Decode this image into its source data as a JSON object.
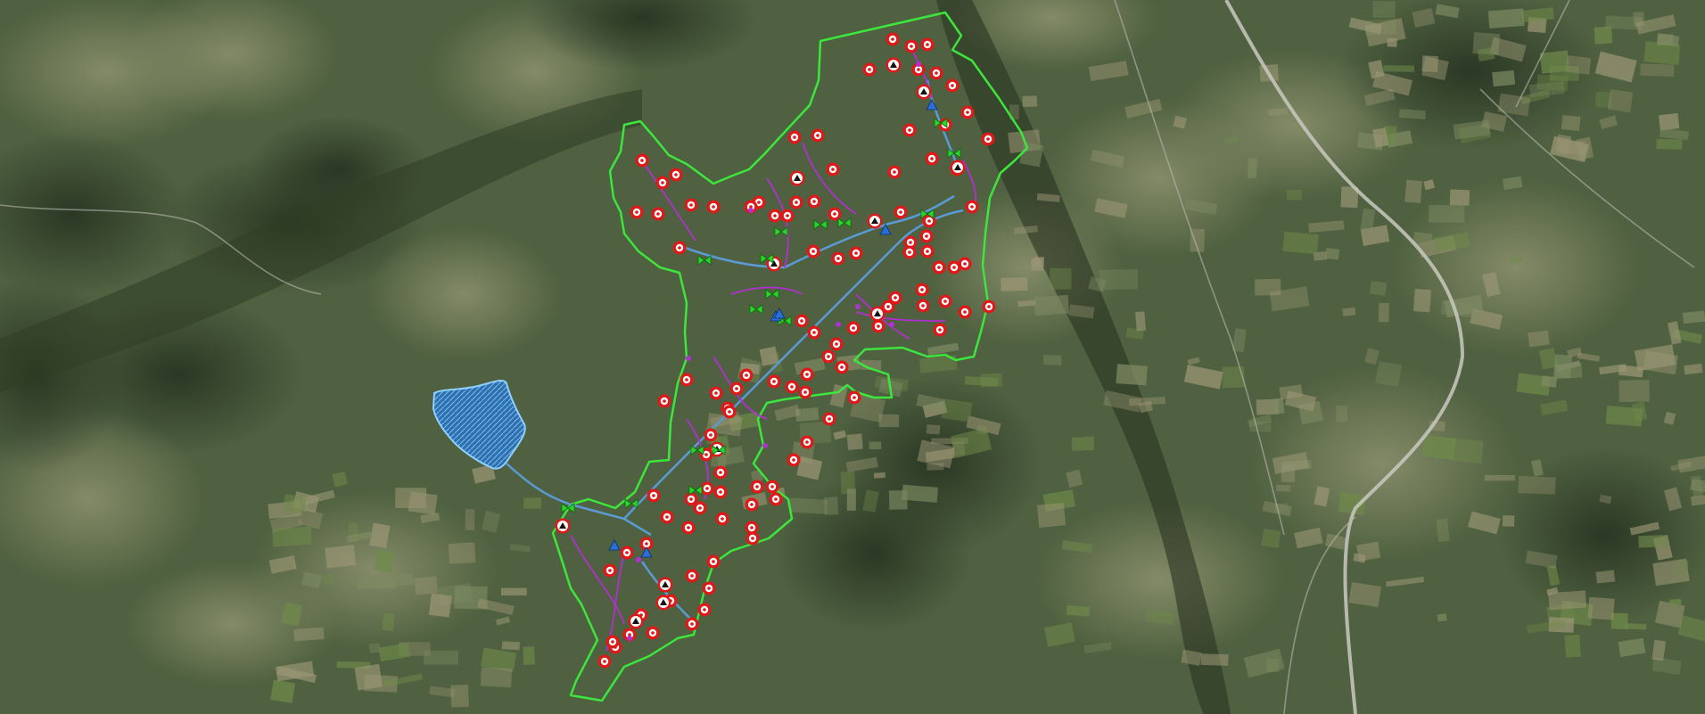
{
  "map": {
    "type": "satellite-irrigation-network-map",
    "colors": {
      "terrain_base": "#4f6140",
      "terrain_dark": "#2f3e25",
      "terrain_light": "#7d8a62",
      "field_tan": "#9b9674",
      "field_green": "#6f8a4a",
      "boundary": "#3ce63c",
      "reservoir_fill": "#2f6fae",
      "reservoir_stroke": "#8fd0ff",
      "pipe_main": "#5a9bd4",
      "pipe_secondary": "#b030d0",
      "pipe_tertiary": "#d03060",
      "hydrant_ring": "#e01818",
      "valve_green": "#2ad42a",
      "pump_blue": "#2a6fd8",
      "tank_black": "#101010",
      "road_grey": "#b8b8b0",
      "river_dark": "#2a3322"
    },
    "layers": [
      "satellite-imagery",
      "irrigation-boundary",
      "reservoir",
      "pipe-network",
      "hydrants",
      "valves",
      "pumping-nodes",
      "tanks"
    ],
    "symbol_types": [
      "hydrant-icon",
      "valve-icon",
      "pump-icon",
      "tank-warning-icon"
    ]
  }
}
